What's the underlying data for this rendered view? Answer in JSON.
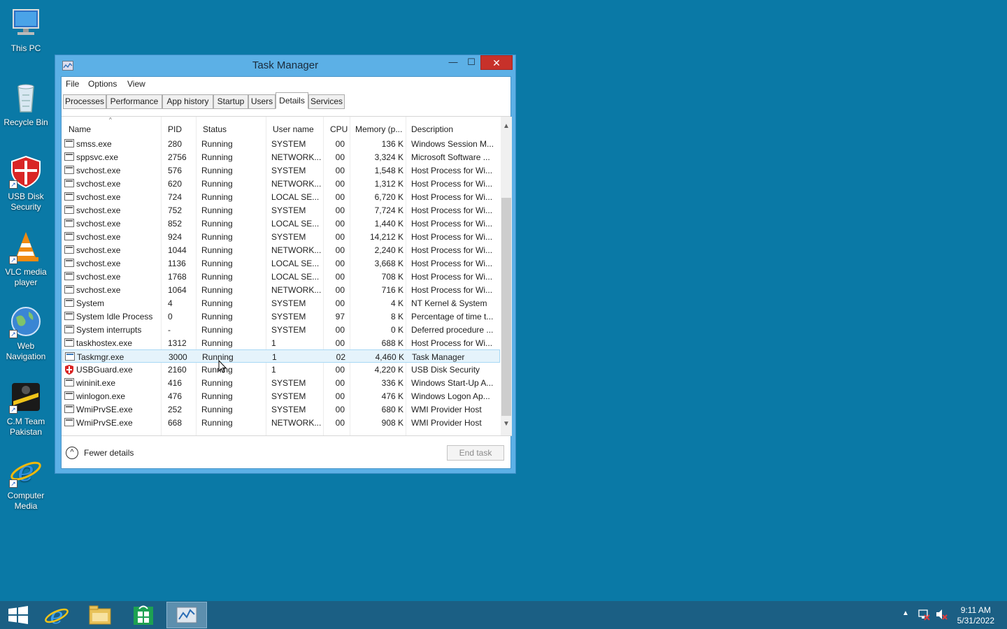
{
  "desktop": {
    "icons": [
      {
        "label": "This PC",
        "icon": "computer-icon"
      },
      {
        "label": "Recycle Bin",
        "icon": "recycle-bin-icon"
      },
      {
        "label": "USB Disk Security",
        "icon": "usb-disk-security-icon"
      },
      {
        "label": "VLC media player",
        "icon": "vlc-icon"
      },
      {
        "label": "Web Navigation",
        "icon": "globe-icon"
      },
      {
        "label": "C.M Team Pakistan",
        "icon": "cm-team-icon"
      },
      {
        "label": "Computer Media",
        "icon": "internet-explorer-icon"
      }
    ]
  },
  "window": {
    "title": "Task Manager",
    "close_glyph": "✕",
    "min_glyph": "—",
    "max_glyph": "☐",
    "menu": [
      "File",
      "Options",
      "View"
    ],
    "tabs": [
      "Processes",
      "Performance",
      "App history",
      "Startup",
      "Users",
      "Details",
      "Services"
    ],
    "active_tab": "Details",
    "columns": [
      "Name",
      "PID",
      "Status",
      "User name",
      "CPU",
      "Memory (p...",
      "Description"
    ],
    "rows": [
      {
        "name": "smss.exe",
        "pid": "280",
        "status": "Running",
        "user": "SYSTEM",
        "cpu": "00",
        "memory": "136 K",
        "description": "Windows Session M..."
      },
      {
        "name": "sppsvc.exe",
        "pid": "2756",
        "status": "Running",
        "user": "NETWORK...",
        "cpu": "00",
        "memory": "3,324 K",
        "description": "Microsoft Software ..."
      },
      {
        "name": "svchost.exe",
        "pid": "576",
        "status": "Running",
        "user": "SYSTEM",
        "cpu": "00",
        "memory": "1,548 K",
        "description": "Host Process for Wi..."
      },
      {
        "name": "svchost.exe",
        "pid": "620",
        "status": "Running",
        "user": "NETWORK...",
        "cpu": "00",
        "memory": "1,312 K",
        "description": "Host Process for Wi..."
      },
      {
        "name": "svchost.exe",
        "pid": "724",
        "status": "Running",
        "user": "LOCAL SE...",
        "cpu": "00",
        "memory": "6,720 K",
        "description": "Host Process for Wi..."
      },
      {
        "name": "svchost.exe",
        "pid": "752",
        "status": "Running",
        "user": "SYSTEM",
        "cpu": "00",
        "memory": "7,724 K",
        "description": "Host Process for Wi..."
      },
      {
        "name": "svchost.exe",
        "pid": "852",
        "status": "Running",
        "user": "LOCAL SE...",
        "cpu": "00",
        "memory": "1,440 K",
        "description": "Host Process for Wi..."
      },
      {
        "name": "svchost.exe",
        "pid": "924",
        "status": "Running",
        "user": "SYSTEM",
        "cpu": "00",
        "memory": "14,212 K",
        "description": "Host Process for Wi..."
      },
      {
        "name": "svchost.exe",
        "pid": "1044",
        "status": "Running",
        "user": "NETWORK...",
        "cpu": "00",
        "memory": "2,240 K",
        "description": "Host Process for Wi..."
      },
      {
        "name": "svchost.exe",
        "pid": "1136",
        "status": "Running",
        "user": "LOCAL SE...",
        "cpu": "00",
        "memory": "3,668 K",
        "description": "Host Process for Wi..."
      },
      {
        "name": "svchost.exe",
        "pid": "1768",
        "status": "Running",
        "user": "LOCAL SE...",
        "cpu": "00",
        "memory": "708 K",
        "description": "Host Process for Wi..."
      },
      {
        "name": "svchost.exe",
        "pid": "1064",
        "status": "Running",
        "user": "NETWORK...",
        "cpu": "00",
        "memory": "716 K",
        "description": "Host Process for Wi..."
      },
      {
        "name": "System",
        "pid": "4",
        "status": "Running",
        "user": "SYSTEM",
        "cpu": "00",
        "memory": "4 K",
        "description": "NT Kernel & System"
      },
      {
        "name": "System Idle Process",
        "pid": "0",
        "status": "Running",
        "user": "SYSTEM",
        "cpu": "97",
        "memory": "8 K",
        "description": "Percentage of time t..."
      },
      {
        "name": "System interrupts",
        "pid": "-",
        "status": "Running",
        "user": "SYSTEM",
        "cpu": "00",
        "memory": "0 K",
        "description": "Deferred procedure ..."
      },
      {
        "name": "taskhostex.exe",
        "pid": "1312",
        "status": "Running",
        "user": "1",
        "cpu": "00",
        "memory": "688 K",
        "description": "Host Process for Wi..."
      },
      {
        "name": "Taskmgr.exe",
        "pid": "3000",
        "status": "Running",
        "user": "1",
        "cpu": "02",
        "memory": "4,460 K",
        "description": "Task Manager",
        "selected": true,
        "icon": "chart"
      },
      {
        "name": "USBGuard.exe",
        "pid": "2160",
        "status": "Running",
        "user": "1",
        "cpu": "00",
        "memory": "4,220 K",
        "description": "USB Disk Security",
        "icon": "shield"
      },
      {
        "name": "wininit.exe",
        "pid": "416",
        "status": "Running",
        "user": "SYSTEM",
        "cpu": "00",
        "memory": "336 K",
        "description": "Windows Start-Up A..."
      },
      {
        "name": "winlogon.exe",
        "pid": "476",
        "status": "Running",
        "user": "SYSTEM",
        "cpu": "00",
        "memory": "476 K",
        "description": "Windows Logon Ap..."
      },
      {
        "name": "WmiPrvSE.exe",
        "pid": "252",
        "status": "Running",
        "user": "SYSTEM",
        "cpu": "00",
        "memory": "680 K",
        "description": "WMI Provider Host",
        "icon": "wmi"
      },
      {
        "name": "WmiPrvSE.exe",
        "pid": "668",
        "status": "Running",
        "user": "NETWORK...",
        "cpu": "00",
        "memory": "908 K",
        "description": "WMI Provider Host",
        "icon": "wmi"
      }
    ],
    "fewer_details": "Fewer details",
    "end_task": "End task"
  },
  "taskbar": {
    "apps": [
      "start-icon",
      "internet-explorer-icon",
      "file-explorer-icon",
      "store-icon",
      "task-manager-icon"
    ],
    "time": "9:11 AM",
    "date": "5/31/2022",
    "tray_chevron": "▲"
  },
  "colors": {
    "desktop": "#0a79a6",
    "taskbar": "#1b5f84",
    "window_frame": "#5cb0e6",
    "close_button": "#c7312a",
    "selection": "#e5f3fb"
  }
}
